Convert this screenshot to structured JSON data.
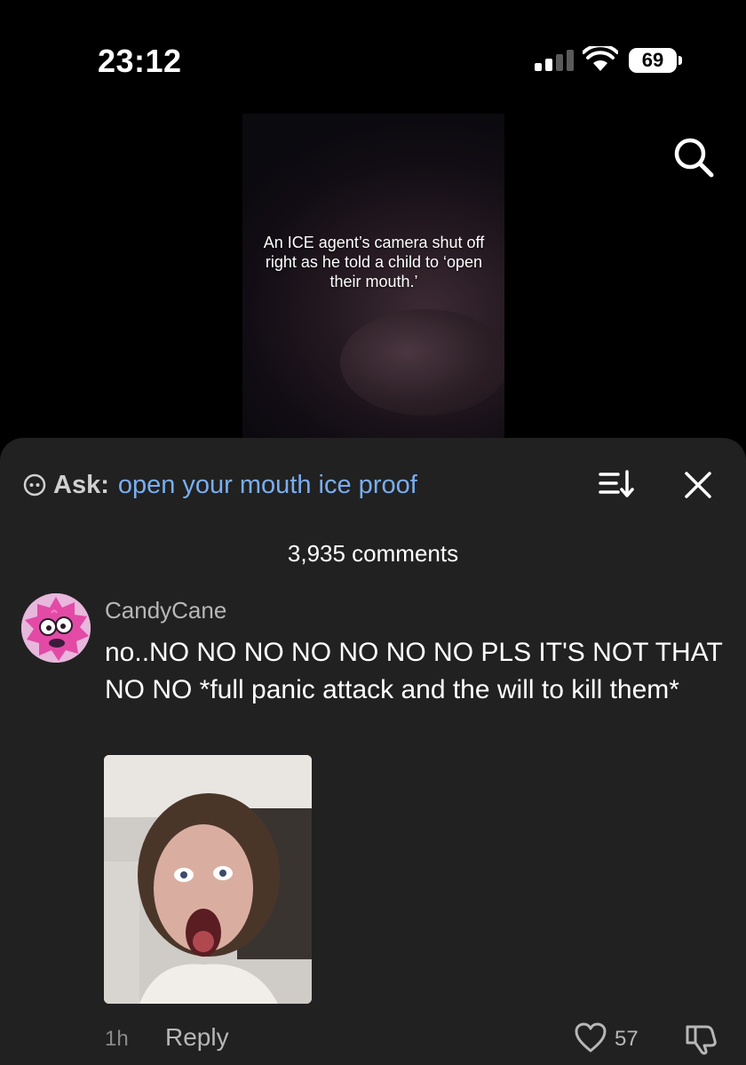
{
  "status_bar": {
    "time": "23:12",
    "battery": "69",
    "icons": [
      "signal-icon",
      "wifi-icon",
      "battery-icon"
    ]
  },
  "video": {
    "caption": "An ICE agent’s camera shut off right as he told a child to ‘open their mouth.’",
    "search_icon": "search-icon"
  },
  "comments_sheet": {
    "ask_label": "Ask:",
    "ask_query": "open your mouth ice proof",
    "ask_icon": "ai-assistant-icon",
    "sort_icon": "sort-icon",
    "close_icon": "close-icon",
    "count_label": "3,935 comments",
    "comments": [
      {
        "username": "CandyCane",
        "text": "no..NO NO NO NO NO NO NO PLS IT'S NOT THAT NO NO *full panic attack and the will to kill them*",
        "time": "1h",
        "reply_label": "Reply",
        "likes": "57"
      }
    ]
  },
  "colors": {
    "sheet_bg": "#212121",
    "ask_query": "#79aef2",
    "muted_text": "#b7b7b7"
  }
}
